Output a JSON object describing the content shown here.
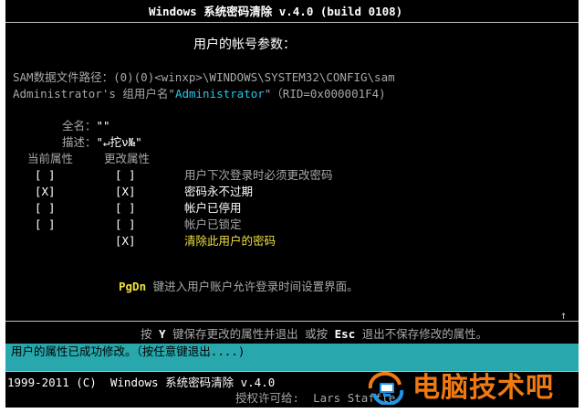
{
  "title": "Windows 系统密码清除 v.4.0 (build 0108)",
  "heading": "用户的帐号参数：",
  "sam_path": "SAM数据文件路径：(0)(0)<winxp>\\WINDOWS\\SYSTEM32\\CONFIG\\sam",
  "account": {
    "prefix": "Administrator's 组用户名\"",
    "name": "Administrator",
    "suffix": "\"（RID=0x000001F4)"
  },
  "fullname": {
    "label": "全名：",
    "value": "\"\""
  },
  "description": {
    "label": "描述：",
    "value": "\"↵拕ν№\""
  },
  "columns": {
    "current": "当前属性",
    "change": "更改属性"
  },
  "attributes": [
    {
      "current": "[ ]",
      "change": "[ ]",
      "label": "用户下次登录时必须更改密码",
      "color": "#a8a8a8"
    },
    {
      "current": "[X]",
      "change": "[X]",
      "label": "密码永不过期",
      "color": "#ffffff"
    },
    {
      "current": "[ ]",
      "change": "[ ]",
      "label": "帐户已停用",
      "color": "#ffffff"
    },
    {
      "current": "[ ]",
      "change": "[ ]",
      "label": "帐户已锁定",
      "color": "#a8a8a8"
    },
    {
      "current": "",
      "change": "[X]",
      "label": "清除此用户的密码",
      "color": "#f0e040"
    }
  ],
  "pgdn": {
    "key": "PgDn",
    "text": "键进入用户账户允许登录时间设置界面。"
  },
  "instruction": {
    "pre": "按 ",
    "key1": "Y",
    "mid": " 键保存更改的属性并退出 或按 ",
    "key2": "Esc",
    "post": " 退出不保存修改的属性。"
  },
  "status": "用户的属性已成功修改。（按任意键退出....)",
  "footer": "1999-2011 (C)  Windows 系统密码清除 v.4.0",
  "footer2": "授权许可给:  Lars Staffle",
  "watermark": "电脑技术吧",
  "colors": {
    "accent": "#28a8ac",
    "highlight": "#22c8e8",
    "warning": "#f0e040",
    "logo": "#f07a10"
  }
}
